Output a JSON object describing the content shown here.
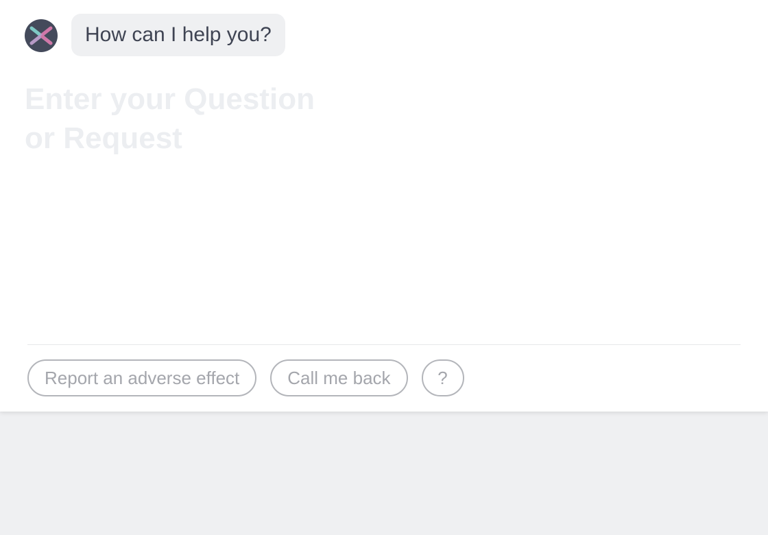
{
  "chat": {
    "avatar_icon": "x-logo-icon",
    "greeting": "How can I help you?"
  },
  "input": {
    "placeholder": "Enter your Question\nor Request",
    "value": ""
  },
  "actions": {
    "report_label": "Report an adverse effect",
    "callback_label": "Call me back",
    "help_label": "?"
  },
  "colors": {
    "avatar_bg": "#444a5b",
    "logo_teal": "#7ec8c4",
    "logo_pink": "#d077a8",
    "bubble_bg": "#eff0f2",
    "page_bg": "#eff0f2",
    "pill_border": "#b3b5ba",
    "pill_text": "#a4a6ac"
  }
}
